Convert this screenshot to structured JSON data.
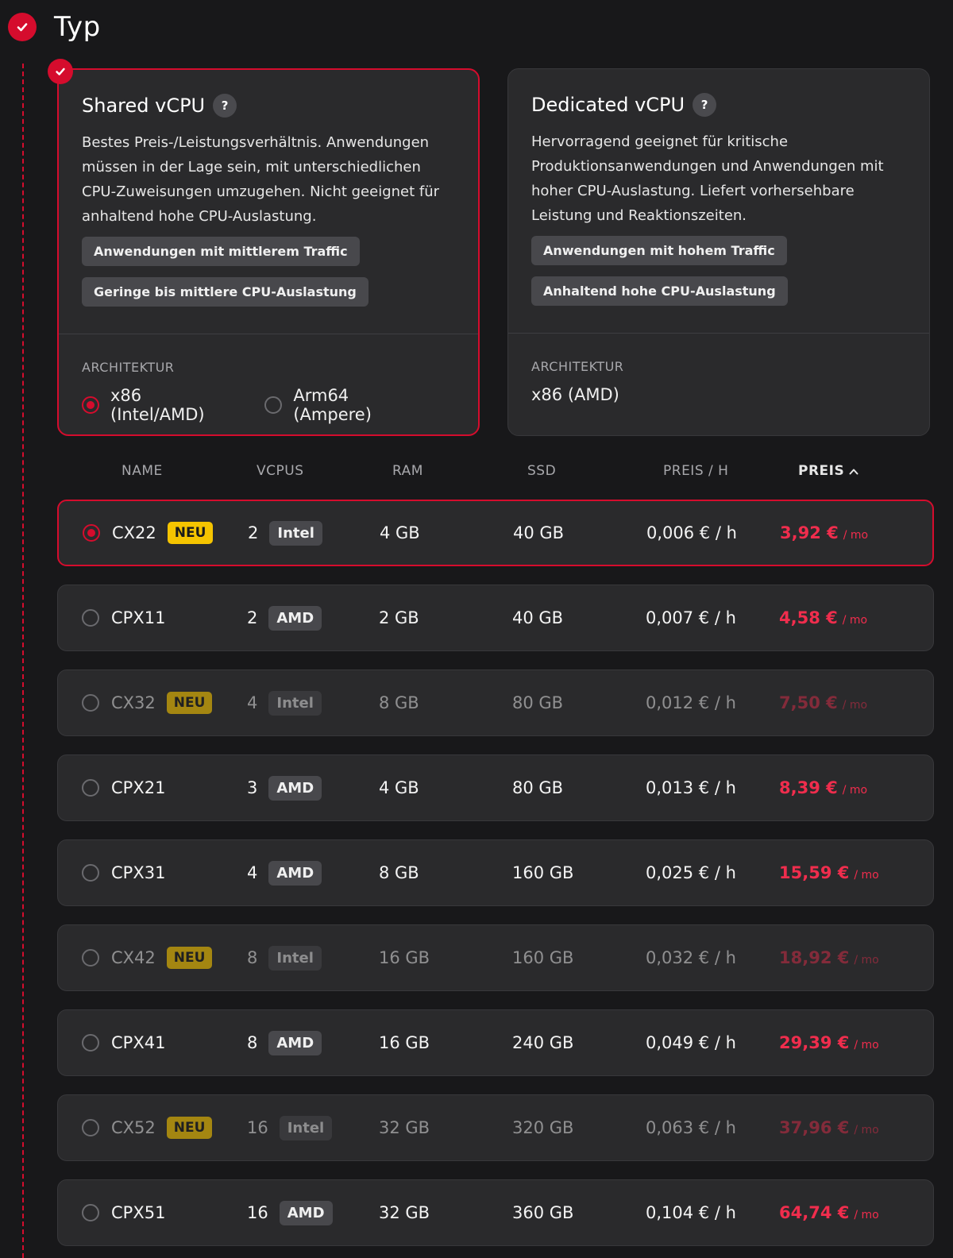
{
  "section": {
    "title": "Typ"
  },
  "cards": {
    "shared": {
      "title": "Shared vCPU",
      "help": "?",
      "description": "Bestes Preis-/Leistungsverhältnis. Anwendungen müssen in der Lage sein, mit unterschiedlichen CPU-Zuweisungen umzugehen. Nicht geeignet für anhaltend hohe CPU-Auslastung.",
      "tags": [
        "Anwendungen mit mittlerem Traffic",
        "Geringe bis mittlere CPU-Auslastung"
      ],
      "arch_label": "ARCHITEKTUR",
      "arch_options": [
        "x86 (Intel/AMD)",
        "Arm64 (Ampere)"
      ]
    },
    "dedicated": {
      "title": "Dedicated vCPU",
      "help": "?",
      "description": "Hervorragend geeignet für kritische Produktionsanwendungen und Anwendungen mit hoher CPU-Auslastung. Liefert vorhersehbare Leistung und Reaktionszeiten.",
      "tags": [
        "Anwendungen mit hohem Traffic",
        "Anhaltend hohe CPU-Auslastung"
      ],
      "arch_label": "ARCHITEKTUR",
      "arch_value": "x86 (AMD)"
    }
  },
  "table": {
    "headers": {
      "name": "NAME",
      "vcpus": "VCPUS",
      "ram": "RAM",
      "ssd": "SSD",
      "price_h": "PREIS / H",
      "price": "PREIS",
      "sort_arrow": "^"
    },
    "new_label": "NEU",
    "per_month": "/ mo",
    "rows": [
      {
        "name": "CX22",
        "new": true,
        "vcpu": "2",
        "cpu": "Intel",
        "ram": "4 GB",
        "ssd": "40 GB",
        "price_h": "0,006 € / h",
        "price": "3,92 €",
        "selected": true,
        "dim": false
      },
      {
        "name": "CPX11",
        "new": false,
        "vcpu": "2",
        "cpu": "AMD",
        "ram": "2 GB",
        "ssd": "40 GB",
        "price_h": "0,007 € / h",
        "price": "4,58 €",
        "selected": false,
        "dim": false
      },
      {
        "name": "CX32",
        "new": true,
        "vcpu": "4",
        "cpu": "Intel",
        "ram": "8 GB",
        "ssd": "80 GB",
        "price_h": "0,012 € / h",
        "price": "7,50 €",
        "selected": false,
        "dim": true
      },
      {
        "name": "CPX21",
        "new": false,
        "vcpu": "3",
        "cpu": "AMD",
        "ram": "4 GB",
        "ssd": "80 GB",
        "price_h": "0,013 € / h",
        "price": "8,39 €",
        "selected": false,
        "dim": false
      },
      {
        "name": "CPX31",
        "new": false,
        "vcpu": "4",
        "cpu": "AMD",
        "ram": "8 GB",
        "ssd": "160 GB",
        "price_h": "0,025 € / h",
        "price": "15,59 €",
        "selected": false,
        "dim": false
      },
      {
        "name": "CX42",
        "new": true,
        "vcpu": "8",
        "cpu": "Intel",
        "ram": "16 GB",
        "ssd": "160 GB",
        "price_h": "0,032 € / h",
        "price": "18,92 €",
        "selected": false,
        "dim": true
      },
      {
        "name": "CPX41",
        "new": false,
        "vcpu": "8",
        "cpu": "AMD",
        "ram": "16 GB",
        "ssd": "240 GB",
        "price_h": "0,049 € / h",
        "price": "29,39 €",
        "selected": false,
        "dim": false
      },
      {
        "name": "CX52",
        "new": true,
        "vcpu": "16",
        "cpu": "Intel",
        "ram": "32 GB",
        "ssd": "320 GB",
        "price_h": "0,063 € / h",
        "price": "37,96 €",
        "selected": false,
        "dim": true
      },
      {
        "name": "CPX51",
        "new": false,
        "vcpu": "16",
        "cpu": "AMD",
        "ram": "32 GB",
        "ssd": "360 GB",
        "price_h": "0,104 € / h",
        "price": "64,74 €",
        "selected": false,
        "dim": false
      }
    ]
  },
  "colors": {
    "accent": "#d50c2d",
    "price": "#f02d4d",
    "new_badge": "#f5c400"
  }
}
